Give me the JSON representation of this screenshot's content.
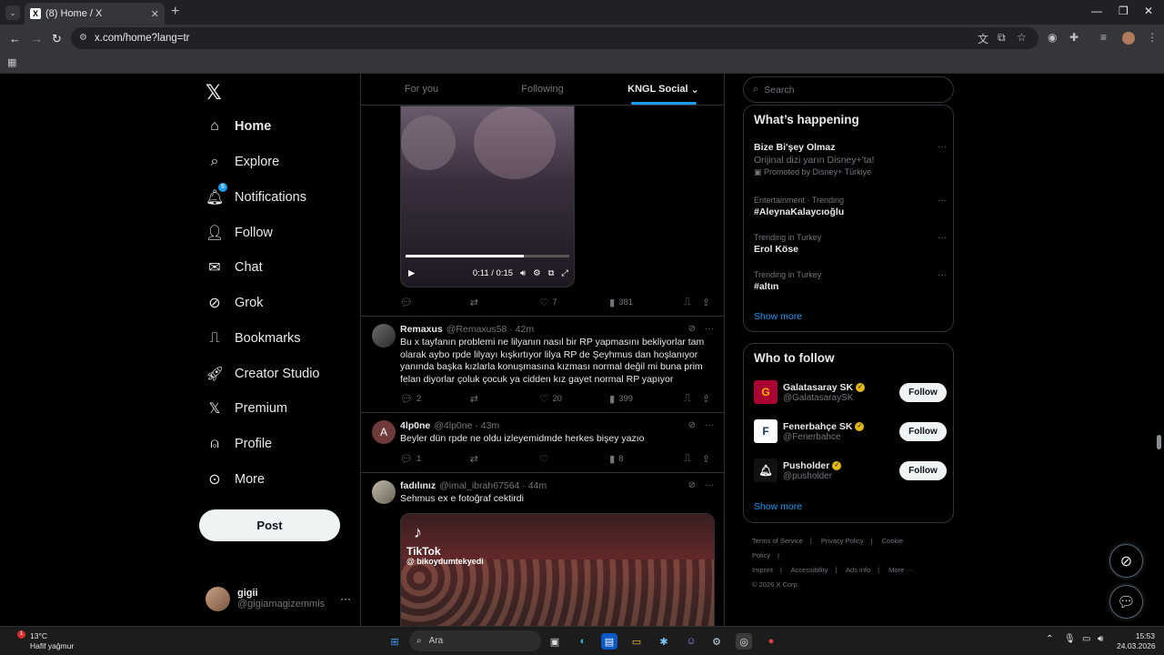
{
  "browser": {
    "tab_title": "(8) Home / X",
    "tab_close": "✕",
    "new_tab": "+",
    "url": "x.com/home?lang=tr"
  },
  "nav": {
    "items": [
      {
        "label": "Home",
        "icon": "home-icon"
      },
      {
        "label": "Explore",
        "icon": "search-icon"
      },
      {
        "label": "Notifications",
        "icon": "bell-icon",
        "badge": "8"
      },
      {
        "label": "Follow",
        "icon": "person-plus-icon"
      },
      {
        "label": "Chat",
        "icon": "mail-icon"
      },
      {
        "label": "Grok",
        "icon": "grok-icon"
      },
      {
        "label": "Bookmarks",
        "icon": "bookmark-icon"
      },
      {
        "label": "Creator Studio",
        "icon": "rocket-icon"
      },
      {
        "label": "Premium",
        "icon": "x-icon"
      },
      {
        "label": "Profile",
        "icon": "person-icon"
      },
      {
        "label": "More",
        "icon": "more-circle-icon"
      }
    ],
    "post_label": "Post",
    "user": {
      "name": "gigii",
      "handle": "@gigiamagizemmis"
    }
  },
  "feed": {
    "tabs": [
      "For you",
      "Following",
      "KNGL Social"
    ],
    "video": {
      "time": "0:11 / 0:15",
      "progress": 0.72
    },
    "video_actions": {
      "replies": "",
      "reposts": "",
      "likes": "7",
      "views": "381"
    },
    "tweets": [
      {
        "name": "Remaxus",
        "handle": "@Remaxus58 · 42m",
        "text": "Bu x tayfanın problemi ne lilyanın nasıl bir RP yapmasını bekliyorlar tam olarak aybo rpde lilyayı kışkırtıyor lilya RP de Şeyhmus dan hoşlanıyor yanında başka kızlarla konuşmasına kızması normal değil mi buna prim felan diyorlar çoluk çocuk ya cidden kız gayet normal RP yapıyor",
        "replies": "2",
        "reposts": "",
        "likes": "20",
        "views": "399"
      },
      {
        "name": "4lp0ne",
        "handle": "@4lp0ne · 43m",
        "avatar_letter": "A",
        "text": "Beyler dün rpde ne oldu izleyemidmde herkes bişey yazıo",
        "replies": "1",
        "reposts": "",
        "likes": "",
        "views": "8"
      },
      {
        "name": "fadılınız",
        "handle": "@imal_ibrah67564 · 44m",
        "text": "Sehmus ex e fotoğraf cektirdi",
        "media": {
          "brand": "TikTok",
          "user": "@ bikoydumtekyedi"
        }
      }
    ]
  },
  "right": {
    "search_placeholder": "Search",
    "happening_title": "What’s happening",
    "trends": [
      {
        "title": "Bize Bi'şey Olmaz",
        "sub": "Orijinal dizi yarın Disney+'ta!",
        "meta": "Promoted by Disney+ Türkiye"
      },
      {
        "meta": "Entertainment · Trending",
        "title": "#AleynaKalaycıoğlu"
      },
      {
        "meta": "Trending in Turkey",
        "title": "Erol Köse"
      },
      {
        "meta": "Trending in Turkey",
        "title": "#altın"
      }
    ],
    "show_more": "Show more",
    "who_title": "Who to follow",
    "who": [
      {
        "name": "Galatasaray SK",
        "handle": "@GalatasaraySK",
        "color": "#a90432"
      },
      {
        "name": "Fenerbahçe SK",
        "handle": "@Fenerbahce",
        "color": "#163962"
      },
      {
        "name": "Pusholder",
        "handle": "@pusholder",
        "color": "#111111"
      }
    ],
    "follow_label": "Follow",
    "footer": [
      "Terms of Service",
      "|",
      "Privacy Policy",
      "|",
      "Cookie Policy",
      "|",
      "Imprint",
      "|",
      "Accessibility",
      "|",
      "Ads info",
      "|",
      "More ···",
      "© 2026 X Corp."
    ]
  },
  "taskbar": {
    "weather_temp": "13°C",
    "weather_desc": "Hafif yağmur",
    "weather_badge": "1",
    "search_label": "Ara",
    "time": "15:53",
    "date": "24.03.2026"
  }
}
